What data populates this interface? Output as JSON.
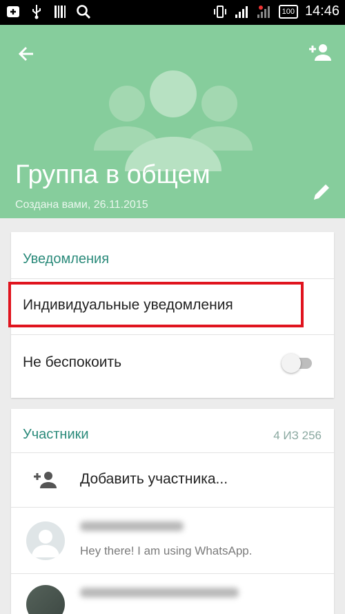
{
  "status_bar": {
    "time": "14:46",
    "battery": "100"
  },
  "header": {
    "title": "Группа в общем",
    "subtitle": "Создана вами, 26.11.2015",
    "color": "#86cd9c"
  },
  "notifications": {
    "section_title": "Уведомления",
    "custom_label": "Индивидуальные уведомления",
    "mute_label": "Не беспокоить",
    "mute_enabled": false
  },
  "participants": {
    "section_title": "Участники",
    "count": "4 ИЗ 256",
    "add_label": "Добавить участника...",
    "members": [
      {
        "status": "Hey there! I am using WhatsApp."
      },
      {
        "status": ""
      }
    ]
  },
  "icons": {
    "back": "arrow-back-icon",
    "add_person": "person-add-icon",
    "edit": "pencil-icon"
  },
  "colors": {
    "accent": "#2a8a7a",
    "highlight": "#e0141e"
  }
}
